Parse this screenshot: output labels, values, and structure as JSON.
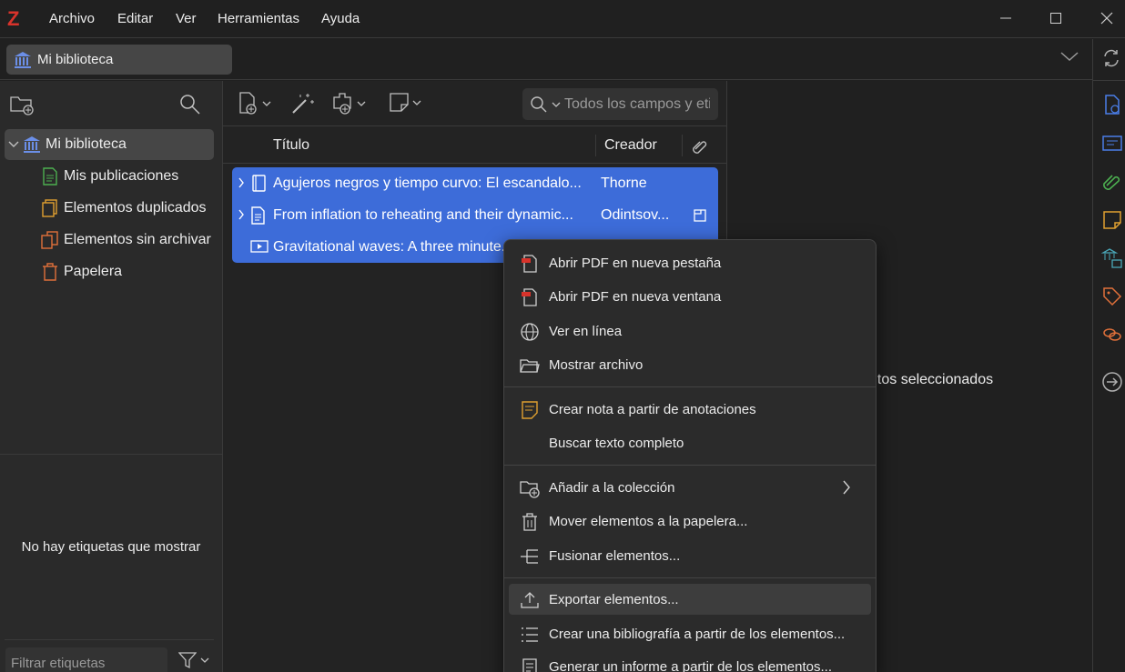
{
  "app": {
    "logo": "Z",
    "menu": [
      "Archivo",
      "Editar",
      "Ver",
      "Herramientas",
      "Ayuda"
    ]
  },
  "tabs": {
    "library_tab_label": "Mi biblioteca"
  },
  "collections": {
    "items": [
      {
        "label": "Mi biblioteca",
        "icon": "library-icon",
        "color": "#6b8fe8"
      },
      {
        "label": "Mis publicaciones",
        "icon": "publications-icon",
        "color": "#4caf50"
      },
      {
        "label": "Elementos duplicados",
        "icon": "duplicates-icon",
        "color": "#e0a030"
      },
      {
        "label": "Elementos sin archivar",
        "icon": "unfiled-icon",
        "color": "#e0703a"
      },
      {
        "label": "Papelera",
        "icon": "trash-icon",
        "color": "#e0703a"
      }
    ],
    "tags_empty_message": "No hay etiquetas que mostrar",
    "tag_filter_placeholder": "Filtrar etiquetas"
  },
  "items_pane": {
    "search_placeholder": "Todos los campos y etiquetas",
    "columns": {
      "title": "Título",
      "creator": "Creador"
    },
    "rows": [
      {
        "title": "Agujeros negros y tiempo curvo: El escandalo...",
        "creator": "Thorne",
        "type_icon": "book-icon"
      },
      {
        "title": "From inflation to reheating and their dynamic...",
        "creator": "Odintsov...",
        "type_icon": "journal-article-icon"
      },
      {
        "title": "Gravitational waves: A three minute...",
        "creator": "",
        "type_icon": "video-icon"
      }
    ]
  },
  "item_pane": {
    "message": "ntos seleccionados"
  },
  "context_menu": {
    "groups": [
      [
        {
          "label": "Abrir PDF en nueva pestaña",
          "icon": "pdf-tab-icon"
        },
        {
          "label": "Abrir PDF en nueva ventana",
          "icon": "pdf-window-icon"
        },
        {
          "label": "Ver en línea",
          "icon": "globe-icon"
        },
        {
          "label": "Mostrar archivo",
          "icon": "folder-icon"
        }
      ],
      [
        {
          "label": "Crear nota a partir de anotaciones",
          "icon": "note-icon"
        },
        {
          "label": "Buscar texto completo",
          "icon": ""
        }
      ],
      [
        {
          "label": "Añadir a la colección",
          "icon": "add-to-collection-icon"
        },
        {
          "label": "Mover elementos a la papelera...",
          "icon": "trash-icon"
        },
        {
          "label": "Fusionar elementos...",
          "icon": "merge-icon"
        }
      ],
      [
        {
          "label": "Exportar elementos...",
          "icon": "export-icon"
        },
        {
          "label": "Crear una bibliografía a partir de los elementos...",
          "icon": "bibliography-icon"
        },
        {
          "label": "Generar un informe a partir de los elementos...",
          "icon": "report-icon"
        }
      ]
    ]
  },
  "colors": {
    "accent": "#3d6cd9",
    "brand": "#d8332b",
    "background": "#202020"
  }
}
